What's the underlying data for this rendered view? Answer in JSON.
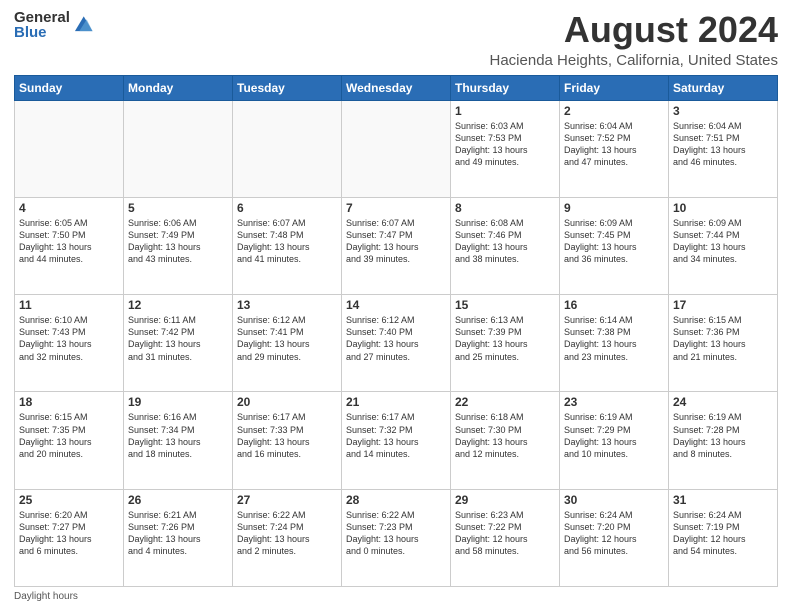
{
  "logo": {
    "general": "General",
    "blue": "Blue"
  },
  "header": {
    "title": "August 2024",
    "subtitle": "Hacienda Heights, California, United States"
  },
  "weekdays": [
    "Sunday",
    "Monday",
    "Tuesday",
    "Wednesday",
    "Thursday",
    "Friday",
    "Saturday"
  ],
  "legend": {
    "daylight": "Daylight hours"
  },
  "weeks": [
    [
      {
        "day": "",
        "info": ""
      },
      {
        "day": "",
        "info": ""
      },
      {
        "day": "",
        "info": ""
      },
      {
        "day": "",
        "info": ""
      },
      {
        "day": "1",
        "info": "Sunrise: 6:03 AM\nSunset: 7:53 PM\nDaylight: 13 hours\nand 49 minutes."
      },
      {
        "day": "2",
        "info": "Sunrise: 6:04 AM\nSunset: 7:52 PM\nDaylight: 13 hours\nand 47 minutes."
      },
      {
        "day": "3",
        "info": "Sunrise: 6:04 AM\nSunset: 7:51 PM\nDaylight: 13 hours\nand 46 minutes."
      }
    ],
    [
      {
        "day": "4",
        "info": "Sunrise: 6:05 AM\nSunset: 7:50 PM\nDaylight: 13 hours\nand 44 minutes."
      },
      {
        "day": "5",
        "info": "Sunrise: 6:06 AM\nSunset: 7:49 PM\nDaylight: 13 hours\nand 43 minutes."
      },
      {
        "day": "6",
        "info": "Sunrise: 6:07 AM\nSunset: 7:48 PM\nDaylight: 13 hours\nand 41 minutes."
      },
      {
        "day": "7",
        "info": "Sunrise: 6:07 AM\nSunset: 7:47 PM\nDaylight: 13 hours\nand 39 minutes."
      },
      {
        "day": "8",
        "info": "Sunrise: 6:08 AM\nSunset: 7:46 PM\nDaylight: 13 hours\nand 38 minutes."
      },
      {
        "day": "9",
        "info": "Sunrise: 6:09 AM\nSunset: 7:45 PM\nDaylight: 13 hours\nand 36 minutes."
      },
      {
        "day": "10",
        "info": "Sunrise: 6:09 AM\nSunset: 7:44 PM\nDaylight: 13 hours\nand 34 minutes."
      }
    ],
    [
      {
        "day": "11",
        "info": "Sunrise: 6:10 AM\nSunset: 7:43 PM\nDaylight: 13 hours\nand 32 minutes."
      },
      {
        "day": "12",
        "info": "Sunrise: 6:11 AM\nSunset: 7:42 PM\nDaylight: 13 hours\nand 31 minutes."
      },
      {
        "day": "13",
        "info": "Sunrise: 6:12 AM\nSunset: 7:41 PM\nDaylight: 13 hours\nand 29 minutes."
      },
      {
        "day": "14",
        "info": "Sunrise: 6:12 AM\nSunset: 7:40 PM\nDaylight: 13 hours\nand 27 minutes."
      },
      {
        "day": "15",
        "info": "Sunrise: 6:13 AM\nSunset: 7:39 PM\nDaylight: 13 hours\nand 25 minutes."
      },
      {
        "day": "16",
        "info": "Sunrise: 6:14 AM\nSunset: 7:38 PM\nDaylight: 13 hours\nand 23 minutes."
      },
      {
        "day": "17",
        "info": "Sunrise: 6:15 AM\nSunset: 7:36 PM\nDaylight: 13 hours\nand 21 minutes."
      }
    ],
    [
      {
        "day": "18",
        "info": "Sunrise: 6:15 AM\nSunset: 7:35 PM\nDaylight: 13 hours\nand 20 minutes."
      },
      {
        "day": "19",
        "info": "Sunrise: 6:16 AM\nSunset: 7:34 PM\nDaylight: 13 hours\nand 18 minutes."
      },
      {
        "day": "20",
        "info": "Sunrise: 6:17 AM\nSunset: 7:33 PM\nDaylight: 13 hours\nand 16 minutes."
      },
      {
        "day": "21",
        "info": "Sunrise: 6:17 AM\nSunset: 7:32 PM\nDaylight: 13 hours\nand 14 minutes."
      },
      {
        "day": "22",
        "info": "Sunrise: 6:18 AM\nSunset: 7:30 PM\nDaylight: 13 hours\nand 12 minutes."
      },
      {
        "day": "23",
        "info": "Sunrise: 6:19 AM\nSunset: 7:29 PM\nDaylight: 13 hours\nand 10 minutes."
      },
      {
        "day": "24",
        "info": "Sunrise: 6:19 AM\nSunset: 7:28 PM\nDaylight: 13 hours\nand 8 minutes."
      }
    ],
    [
      {
        "day": "25",
        "info": "Sunrise: 6:20 AM\nSunset: 7:27 PM\nDaylight: 13 hours\nand 6 minutes."
      },
      {
        "day": "26",
        "info": "Sunrise: 6:21 AM\nSunset: 7:26 PM\nDaylight: 13 hours\nand 4 minutes."
      },
      {
        "day": "27",
        "info": "Sunrise: 6:22 AM\nSunset: 7:24 PM\nDaylight: 13 hours\nand 2 minutes."
      },
      {
        "day": "28",
        "info": "Sunrise: 6:22 AM\nSunset: 7:23 PM\nDaylight: 13 hours\nand 0 minutes."
      },
      {
        "day": "29",
        "info": "Sunrise: 6:23 AM\nSunset: 7:22 PM\nDaylight: 12 hours\nand 58 minutes."
      },
      {
        "day": "30",
        "info": "Sunrise: 6:24 AM\nSunset: 7:20 PM\nDaylight: 12 hours\nand 56 minutes."
      },
      {
        "day": "31",
        "info": "Sunrise: 6:24 AM\nSunset: 7:19 PM\nDaylight: 12 hours\nand 54 minutes."
      }
    ]
  ]
}
